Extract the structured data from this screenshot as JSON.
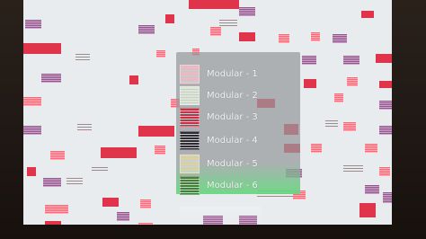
{
  "menu": {
    "items": [
      {
        "label": "Modular - 1",
        "thumb": "#e7b9c2"
      },
      {
        "label": "Modular - 2",
        "thumb": "#d9e7d4"
      },
      {
        "label": "Modular - 3",
        "thumb": "#c23348"
      },
      {
        "label": "Modular - 4",
        "thumb": "#2d2a33"
      },
      {
        "label": "Modular - 5",
        "thumb": "#d8d2a8"
      },
      {
        "label": "Modular - 6",
        "thumb": "#4a7a3c"
      }
    ]
  },
  "colors": {
    "screen": "#e9ecef",
    "red": "#e0344b",
    "pink": "#e8707d",
    "purple": "#8b5a86",
    "highlight": "#5ae678"
  }
}
